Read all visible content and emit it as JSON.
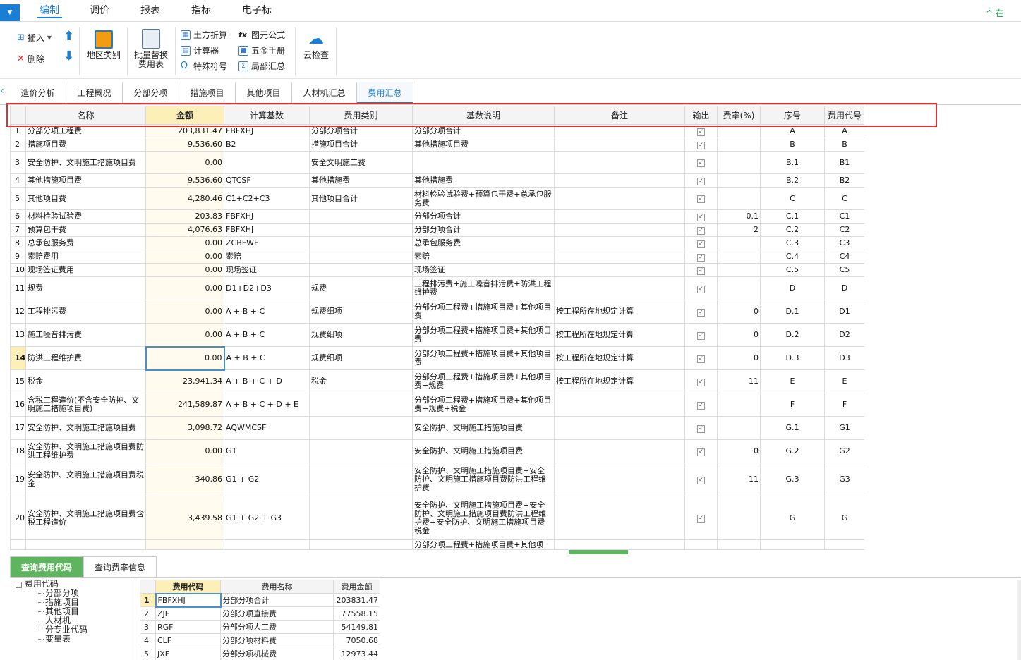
{
  "menu": {
    "app_button": "▼",
    "tabs": [
      "编制",
      "调价",
      "报表",
      "指标",
      "电子标"
    ],
    "active_tab": "编制",
    "right_label": "^ 在"
  },
  "ribbon": {
    "insert": "插入",
    "delete": "删除",
    "region_category": "地区类别",
    "batch_replace": [
      "批量替换",
      "费用表"
    ],
    "earthwork": "土方折算",
    "calculator": "计算器",
    "special_symbol": "特殊符号",
    "formula": "图元公式",
    "hardware_manual": "五金手册",
    "local_summary": "局部汇总",
    "cloud_check": "云检查"
  },
  "subtabs": [
    "造价分析",
    "工程概况",
    "分部分项",
    "措施项目",
    "其他项目",
    "人材机汇总",
    "费用汇总"
  ],
  "active_subtab": "费用汇总",
  "grid": {
    "headers": [
      "名称",
      "金额",
      "计算基数",
      "费用类别",
      "基数说明",
      "备注",
      "输出",
      "费率(%)",
      "序号",
      "费用代号"
    ],
    "rows": [
      {
        "n": "1",
        "name": "分部分项工程费",
        "amount": "203,831.47",
        "base": "FBFXHJ",
        "category": "分部分项合计",
        "desc": "分部分项合计",
        "note": "",
        "rate": "",
        "seq": "A",
        "code": "A"
      },
      {
        "n": "2",
        "name": "措施项目费",
        "amount": "9,536.60",
        "base": "B2",
        "category": "措施项目合计",
        "desc": "其他措施项目费",
        "note": "",
        "rate": "",
        "seq": "B",
        "code": "B"
      },
      {
        "n": "3",
        "name": "安全防护、文明施工措施项目费",
        "amount": "0.00",
        "base": "",
        "category": "安全文明施工费",
        "desc": "",
        "note": "",
        "rate": "",
        "seq": "B.1",
        "code": "B1"
      },
      {
        "n": "4",
        "name": "其他措施项目费",
        "amount": "9,536.60",
        "base": "QTCSF",
        "category": "其他措施费",
        "desc": "其他措施费",
        "note": "",
        "rate": "",
        "seq": "B.2",
        "code": "B2"
      },
      {
        "n": "5",
        "name": "其他项目费",
        "amount": "4,280.46",
        "base": "C1+C2+C3",
        "category": "其他项目合计",
        "desc": "材料检验试验费+预算包干费+总承包服务费",
        "note": "",
        "rate": "",
        "seq": "C",
        "code": "C"
      },
      {
        "n": "6",
        "name": "材料检验试验费",
        "amount": "203.83",
        "base": "FBFXHJ",
        "category": "",
        "desc": "分部分项合计",
        "note": "",
        "rate": "0.1",
        "seq": "C.1",
        "code": "C1"
      },
      {
        "n": "7",
        "name": "预算包干费",
        "amount": "4,076.63",
        "base": "FBFXHJ",
        "category": "",
        "desc": "分部分项合计",
        "note": "",
        "rate": "2",
        "seq": "C.2",
        "code": "C2"
      },
      {
        "n": "8",
        "name": "总承包服务费",
        "amount": "0.00",
        "base": "ZCBFWF",
        "category": "",
        "desc": "总承包服务费",
        "note": "",
        "rate": "",
        "seq": "C.3",
        "code": "C3"
      },
      {
        "n": "9",
        "name": "索赔费用",
        "amount": "0.00",
        "base": "索赔",
        "category": "",
        "desc": "索赔",
        "note": "",
        "rate": "",
        "seq": "C.4",
        "code": "C4"
      },
      {
        "n": "10",
        "name": "现场签证费用",
        "amount": "0.00",
        "base": "现场签证",
        "category": "",
        "desc": "现场签证",
        "note": "",
        "rate": "",
        "seq": "C.5",
        "code": "C5"
      },
      {
        "n": "11",
        "name": "规费",
        "amount": "0.00",
        "base": "D1+D2+D3",
        "category": "规费",
        "desc": "工程排污费+施工噪音排污费+防洪工程维护费",
        "note": "",
        "rate": "",
        "seq": "D",
        "code": "D"
      },
      {
        "n": "12",
        "name": "工程排污费",
        "amount": "0.00",
        "base": "A + B + C",
        "category": "规费细项",
        "desc": "分部分项工程费+措施项目费+其他项目费",
        "note": "按工程所在地规定计算",
        "rate": "0",
        "seq": "D.1",
        "code": "D1"
      },
      {
        "n": "13",
        "name": "施工噪音排污费",
        "amount": "0.00",
        "base": "A + B + C",
        "category": "规费细项",
        "desc": "分部分项工程费+措施项目费+其他项目费",
        "note": "按工程所在地规定计算",
        "rate": "0",
        "seq": "D.2",
        "code": "D2"
      },
      {
        "n": "14",
        "name": "防洪工程维护费",
        "amount": "0.00",
        "base": "A + B + C",
        "category": "规费细项",
        "desc": "分部分项工程费+措施项目费+其他项目费",
        "note": "按工程所在地规定计算",
        "rate": "0",
        "seq": "D.3",
        "code": "D3"
      },
      {
        "n": "15",
        "name": "税金",
        "amount": "23,941.34",
        "base": "A + B + C + D",
        "category": "税金",
        "desc": "分部分项工程费+措施项目费+其他项目费+规费",
        "note": "按工程所在地规定计算",
        "rate": "11",
        "seq": "E",
        "code": "E"
      },
      {
        "n": "16",
        "name": "含税工程造价(不含安全防护、文明施工措施项目费)",
        "amount": "241,589.87",
        "base": "A + B + C + D + E",
        "category": "",
        "desc": "分部分项工程费+措施项目费+其他项目费+规费+税金",
        "note": "",
        "rate": "",
        "seq": "F",
        "code": "F"
      },
      {
        "n": "17",
        "name": "安全防护、文明施工措施项目费",
        "amount": "3,098.72",
        "base": "AQWMCSF",
        "category": "",
        "desc": "安全防护、文明施工措施项目费",
        "note": "",
        "rate": "",
        "seq": "G.1",
        "code": "G1"
      },
      {
        "n": "18",
        "name": "安全防护、文明施工措施项目费防洪工程维护费",
        "amount": "0.00",
        "base": "G1",
        "category": "",
        "desc": "安全防护、文明施工措施项目费",
        "note": "",
        "rate": "0",
        "seq": "G.2",
        "code": "G2"
      },
      {
        "n": "19",
        "name": "安全防护、文明施工措施项目费税金",
        "amount": "340.86",
        "base": "G1 + G2",
        "category": "",
        "desc": "安全防护、文明施工措施项目费+安全防护、文明施工措施项目费防洪工程维护费",
        "note": "",
        "rate": "11",
        "seq": "G.3",
        "code": "G3"
      },
      {
        "n": "20",
        "name": "安全防护、文明施工措施项目费含税工程造价",
        "amount": "3,439.58",
        "base": "G1 + G2 + G3",
        "category": "",
        "desc": "安全防护、文明施工措施项目费+安全防护、文明施工措施项目费防洪工程维护费+安全防护、文明施工措施项目费税金",
        "note": "",
        "rate": "",
        "seq": "G",
        "code": "G"
      },
      {
        "n": "",
        "name": "",
        "amount": "",
        "base": "",
        "category": "",
        "desc": "分部分项工程费+措施项目费+其他项",
        "note": "",
        "rate": "",
        "seq": "",
        "code": ""
      }
    ],
    "selected_row": "14"
  },
  "bottom": {
    "tabs": [
      "查询费用代码",
      "查询费率信息"
    ],
    "active_tab": "查询费用代码",
    "tree_root": "费用代码",
    "tree_children": [
      "分部分项",
      "措施项目",
      "其他项目",
      "人材机",
      "分专业代码",
      "变量表"
    ],
    "sub_headers": [
      "费用代码",
      "费用名称",
      "费用金额"
    ],
    "sub_rows": [
      {
        "n": "1",
        "code": "FBFXHJ",
        "name": "分部分项合计",
        "amount": "203831.47"
      },
      {
        "n": "2",
        "code": "ZJF",
        "name": "分部分项直接费",
        "amount": "77558.15"
      },
      {
        "n": "3",
        "code": "RGF",
        "name": "分部分项人工费",
        "amount": "54149.81"
      },
      {
        "n": "4",
        "code": "CLF",
        "name": "分部分项材料费",
        "amount": "7050.68"
      },
      {
        "n": "5",
        "code": "JXF",
        "name": "分部分项机械费",
        "amount": "12973.44"
      }
    ]
  }
}
